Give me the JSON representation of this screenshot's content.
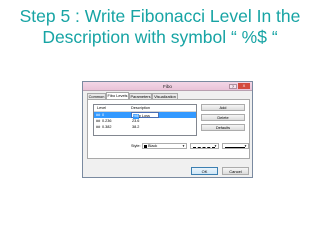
{
  "slide": {
    "title_line1": "Step 5 : Write Fibonacci Level In the",
    "title_line2": "Description with symbol “ %$ “"
  },
  "dialog": {
    "title": "Fibo",
    "help_label": "?",
    "close_label": "X",
    "tabs": [
      "Common",
      "Fibo Levels",
      "Parameters",
      "Visualization"
    ],
    "active_tab": "Fibo Levels",
    "list": {
      "headers": [
        "Level",
        "Description"
      ],
      "rows": [
        {
          "level": "0",
          "description": "Stop Loss",
          "edit_prefix": "Stop Loss ",
          "edit_selected": "%$"
        },
        {
          "level": "0.236",
          "description": "23.6"
        },
        {
          "level": "0.382",
          "description": "38.2"
        }
      ],
      "selected_row": 0
    },
    "buttons": {
      "add": "Add",
      "delete": "Delete",
      "defaults": "Defaults"
    },
    "style": {
      "label": "Style:",
      "color_value": "Black",
      "color_swatch": "#000000",
      "line_style": "dashed",
      "line_width": "thin"
    },
    "footer": {
      "ok": "OK",
      "cancel": "Cancel"
    }
  },
  "colors": {
    "title_text": "#17a4a4",
    "selection": "#3399ff",
    "close_button": "#d34a3e"
  }
}
